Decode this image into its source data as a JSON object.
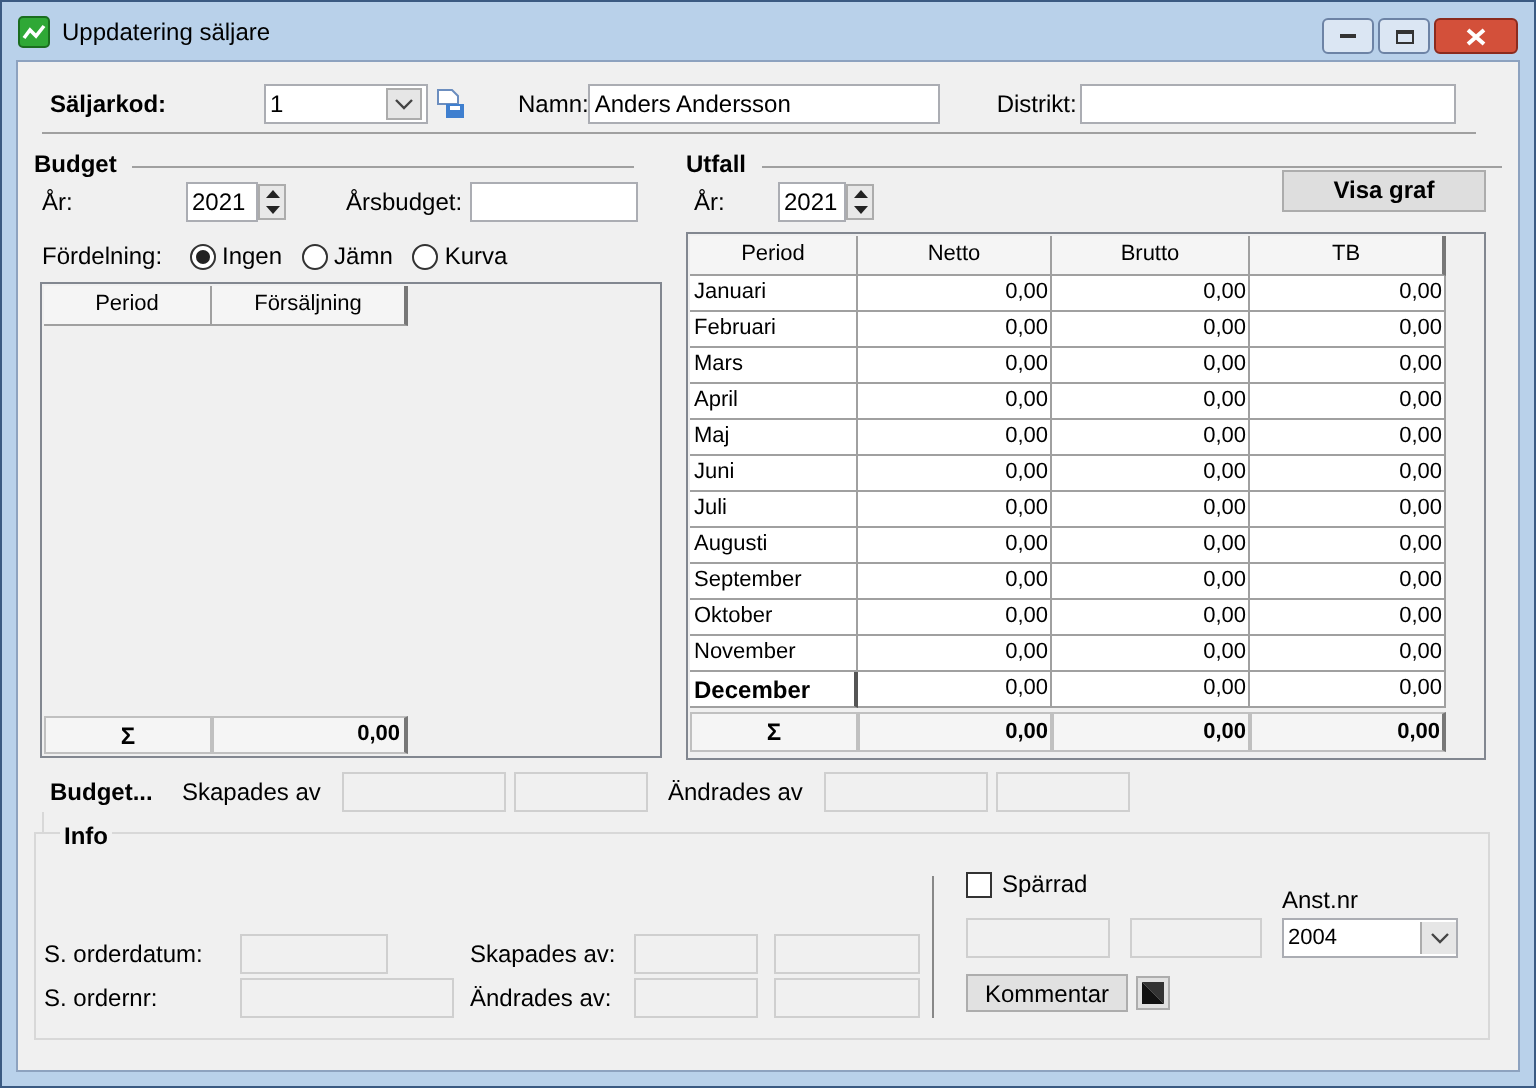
{
  "window": {
    "title": "Uppdatering säljare"
  },
  "header": {
    "code_label": "Säljarkod:",
    "code_value": "1",
    "name_label": "Namn:",
    "name_value": "Anders Andersson",
    "district_label": "Distrikt:"
  },
  "budget": {
    "title": "Budget",
    "year_label": "År:",
    "year": "2021",
    "annual_label": "Årsbudget:",
    "distribution_label": "Fördelning:",
    "options": [
      {
        "label": "Ingen",
        "selected": true
      },
      {
        "label": "Jämn",
        "selected": false
      },
      {
        "label": "Kurva",
        "selected": false
      }
    ],
    "table": {
      "columns": [
        "Period",
        "Försäljning"
      ],
      "sum_symbol": "Σ",
      "sum_value": "0,00"
    }
  },
  "outcome": {
    "title": "Utfall",
    "year_label": "År:",
    "year": "2021",
    "graph_button": "Visa graf",
    "table": {
      "columns": [
        "Period",
        "Netto",
        "Brutto",
        "TB"
      ],
      "rows": [
        {
          "period": "Januari",
          "netto": "0,00",
          "brutto": "0,00",
          "tb": "0,00",
          "selected": false
        },
        {
          "period": "Februari",
          "netto": "0,00",
          "brutto": "0,00",
          "tb": "0,00",
          "selected": false
        },
        {
          "period": "Mars",
          "netto": "0,00",
          "brutto": "0,00",
          "tb": "0,00",
          "selected": false
        },
        {
          "period": "April",
          "netto": "0,00",
          "brutto": "0,00",
          "tb": "0,00",
          "selected": false
        },
        {
          "period": "Maj",
          "netto": "0,00",
          "brutto": "0,00",
          "tb": "0,00",
          "selected": false
        },
        {
          "period": "Juni",
          "netto": "0,00",
          "brutto": "0,00",
          "tb": "0,00",
          "selected": false
        },
        {
          "period": "Juli",
          "netto": "0,00",
          "brutto": "0,00",
          "tb": "0,00",
          "selected": false
        },
        {
          "period": "Augusti",
          "netto": "0,00",
          "brutto": "0,00",
          "tb": "0,00",
          "selected": false
        },
        {
          "period": "September",
          "netto": "0,00",
          "brutto": "0,00",
          "tb": "0,00",
          "selected": false
        },
        {
          "period": "Oktober",
          "netto": "0,00",
          "brutto": "0,00",
          "tb": "0,00",
          "selected": false
        },
        {
          "period": "November",
          "netto": "0,00",
          "brutto": "0,00",
          "tb": "0,00",
          "selected": false
        },
        {
          "period": "December",
          "netto": "0,00",
          "brutto": "0,00",
          "tb": "0,00",
          "selected": true
        }
      ],
      "sum": {
        "symbol": "Σ",
        "netto": "0,00",
        "brutto": "0,00",
        "tb": "0,00"
      }
    }
  },
  "audit": {
    "title": "Budget...",
    "created_label": "Skapades av",
    "changed_label": "Ändrades av"
  },
  "info": {
    "title": "Info",
    "order_date_label": "S. orderdatum:",
    "order_no_label": "S. ordernr:",
    "created_label": "Skapades av:",
    "changed_label": "Ändrades av:",
    "blocked": {
      "label": "Spärrad",
      "checked": false
    },
    "employee_label": "Anst.nr",
    "employee_value": "2004",
    "comment_button": "Kommentar"
  }
}
